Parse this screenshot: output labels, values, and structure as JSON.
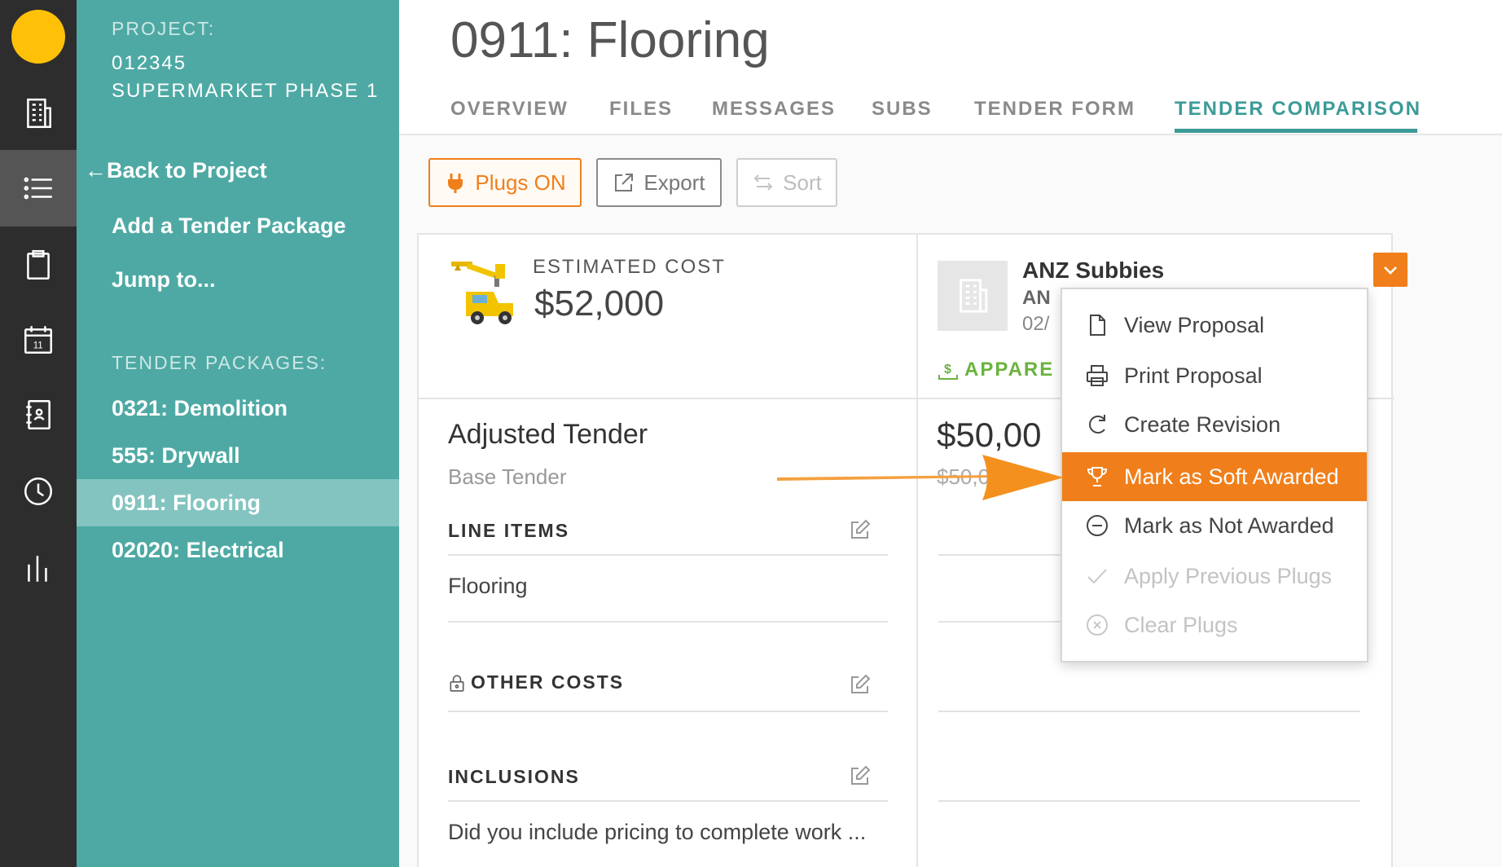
{
  "sidebar": {
    "project_label": "PROJECT:",
    "project_number": "012345",
    "project_name": "SUPERMARKET PHASE 1",
    "back_link": "Back to Project",
    "add_link": "Add a Tender Package",
    "jump_link": "Jump to...",
    "packages_label": "TENDER PACKAGES:",
    "packages": [
      {
        "label": "0321: Demolition"
      },
      {
        "label": "555: Drywall"
      },
      {
        "label": "0911: Flooring"
      },
      {
        "label": "02020: Electrical"
      }
    ]
  },
  "header": {
    "title": "0911: Flooring",
    "tabs": [
      {
        "label": "OVERVIEW"
      },
      {
        "label": "FILES"
      },
      {
        "label": "MESSAGES"
      },
      {
        "label": "SUBS"
      },
      {
        "label": "TENDER FORM"
      },
      {
        "label": "TENDER COMPARISON"
      }
    ]
  },
  "toolbar": {
    "plugs_label": "Plugs ON",
    "export_label": "Export",
    "sort_label": "Sort"
  },
  "estimate": {
    "label": "ESTIMATED COST",
    "value": "$52,000"
  },
  "bidder": {
    "name": "ANZ Subbies",
    "sub1": "AN",
    "sub2": "02/",
    "status": "APPARE",
    "amount": "$50,00",
    "sub_amount": "$50,0"
  },
  "tender": {
    "title": "Adjusted Tender",
    "base": "Base Tender",
    "line_items_label": "LINE ITEMS",
    "line_item": "Flooring",
    "other_costs_label": "OTHER COSTS",
    "inclusions_label": "INCLUSIONS",
    "inclusion_text": "Did you include pricing to complete work ..."
  },
  "menu": {
    "items": [
      {
        "label": "View Proposal"
      },
      {
        "label": "Print Proposal"
      },
      {
        "label": "Create Revision"
      },
      {
        "label": "Mark as Soft Awarded"
      },
      {
        "label": "Mark as Not Awarded"
      },
      {
        "label": "Apply Previous Plugs"
      },
      {
        "label": "Clear Plugs"
      }
    ]
  },
  "colors": {
    "rail": "#2d2d2d",
    "sidebar": "#4ea9a4",
    "sidebar_active": "#83c4c0",
    "accent_teal": "#3d9b98",
    "accent_orange": "#f07f1b",
    "status_green": "#6bb33e"
  }
}
